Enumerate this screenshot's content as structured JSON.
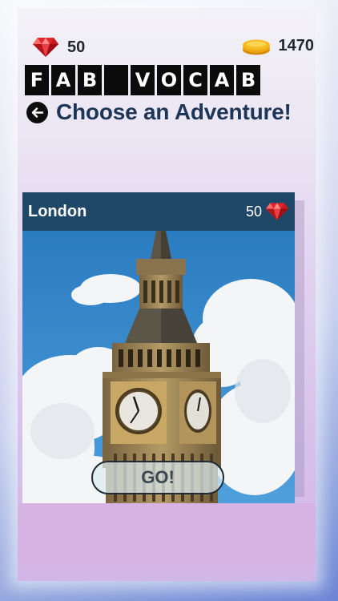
{
  "stats": {
    "gems": "50",
    "coins": "1470",
    "gem_icon": "ruby-gem-icon",
    "coin_icon": "gold-coins-icon"
  },
  "logo": {
    "letters": [
      "F",
      "A",
      "B",
      " ",
      "V",
      "O",
      "C",
      "A",
      "B"
    ]
  },
  "header": {
    "title": "Choose an Adventure!",
    "back_icon": "arrow-left-icon"
  },
  "card": {
    "city": "London",
    "cost": "50",
    "image_subject": "Big Ben clock tower against blue sky with clouds",
    "button_label": "GO!"
  },
  "colors": {
    "title": "#1d3557",
    "card_header": "#1f4768",
    "gem": "#e3262a",
    "coin": "#f2b51c"
  }
}
